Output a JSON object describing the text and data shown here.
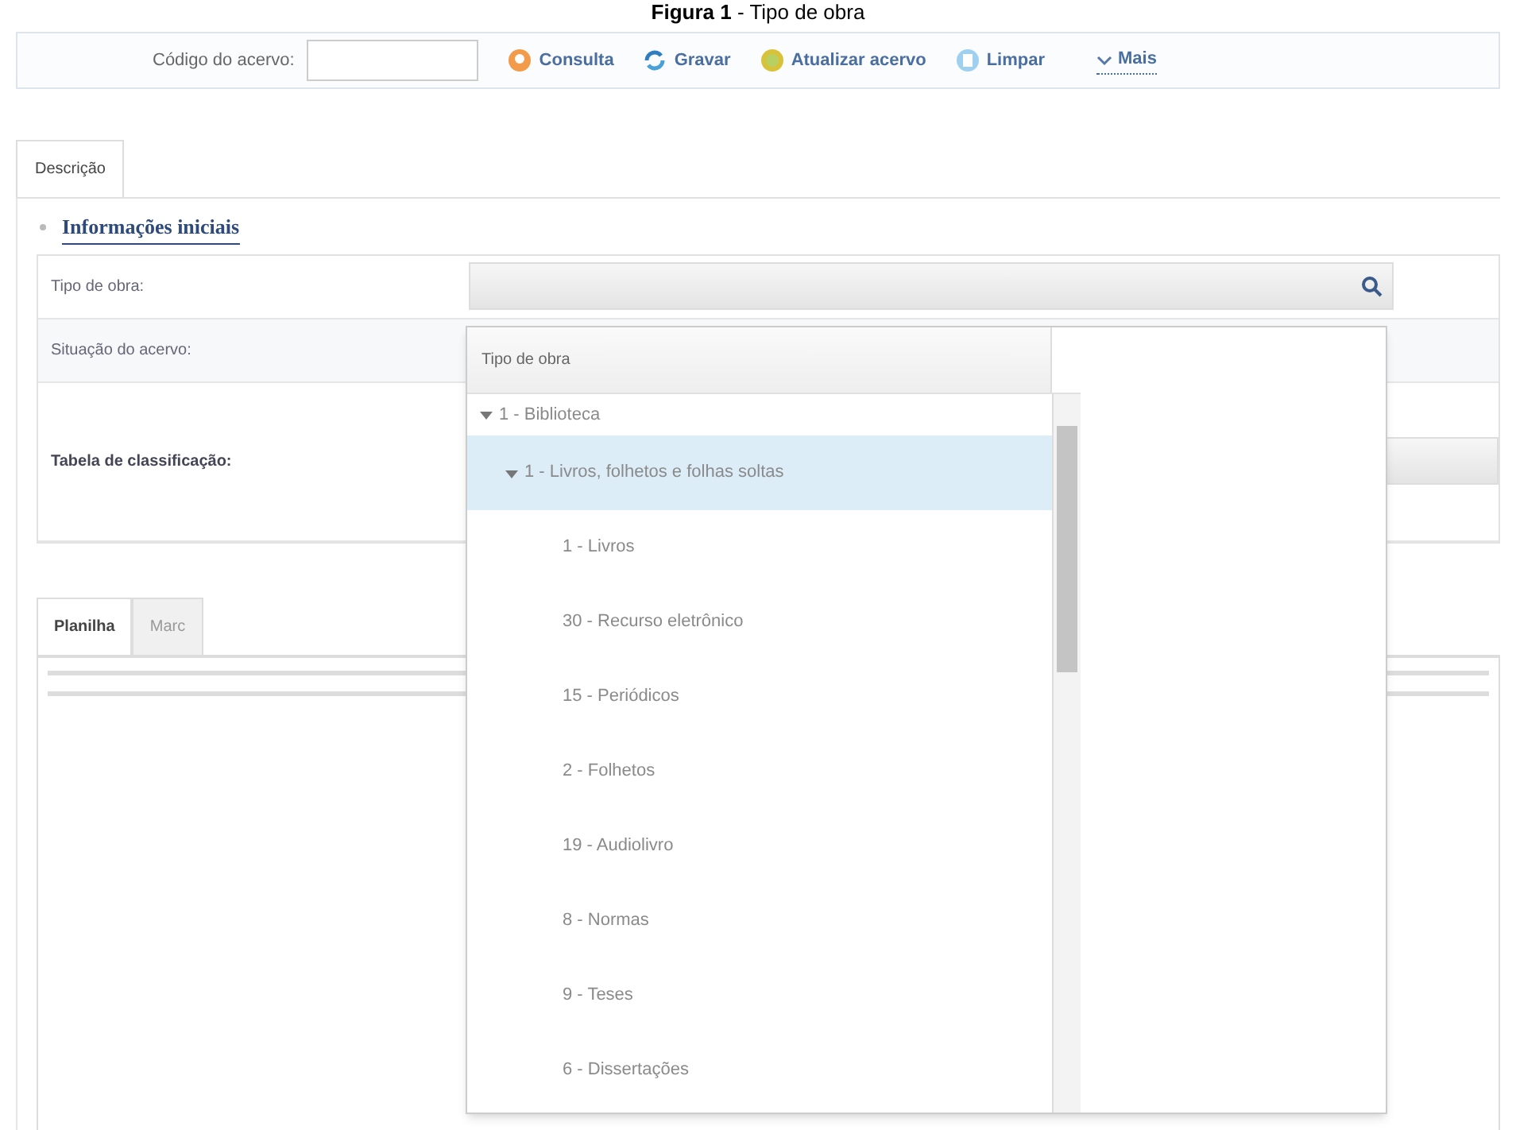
{
  "caption": "**Figura 1** - Tipo de obra",
  "toolbar": {
    "code_label": "Código do acervo:",
    "buttons": [
      {
        "label": "Consulta",
        "kind": "query"
      },
      {
        "label": "Gravar",
        "kind": "save"
      },
      {
        "label": "Atualizar acervo",
        "kind": "refresh"
      },
      {
        "label": "Limpar",
        "kind": "clear"
      },
      {
        "label": "Mais",
        "kind": "more"
      }
    ]
  },
  "tabs": [
    {
      "label": "Descrição",
      "selected": true
    }
  ],
  "section": {
    "title": "Informações iniciais",
    "expanded": true,
    "fields": [
      {
        "label": "Tipo de obra:",
        "kind": "lookup"
      },
      {
        "label": "Situação do acervo:",
        "kind": "plain"
      },
      {
        "label": "Tabela de classificação:",
        "kind": "tall"
      }
    ]
  },
  "bottom_tabs": [
    {
      "label": "Planilha",
      "selected": true
    },
    {
      "label": "Marc",
      "selected": false
    }
  ],
  "dropdown": {
    "column": "Tipo de obra",
    "items": [
      {
        "label": "1 - Biblioteca",
        "expanded": true,
        "selected": false,
        "children": [
          {
            "label": "1 - Livros, folhetos e folhas soltas",
            "expanded": true,
            "selected": true,
            "children": [
              {
                "label": "1 - Livros",
                "selected": false
              },
              {
                "label": "30 - Recurso eletrônico",
                "selected": false
              },
              {
                "label": "15 - Periódicos",
                "selected": false
              },
              {
                "label": "2 - Folhetos",
                "selected": false
              },
              {
                "label": "19 - Audiolivro",
                "selected": false
              },
              {
                "label": "8 - Normas",
                "selected": false
              },
              {
                "label": "9 - Teses",
                "selected": false
              },
              {
                "label": "6 - Dissertações",
                "selected": false
              }
            ]
          }
        ]
      }
    ]
  }
}
